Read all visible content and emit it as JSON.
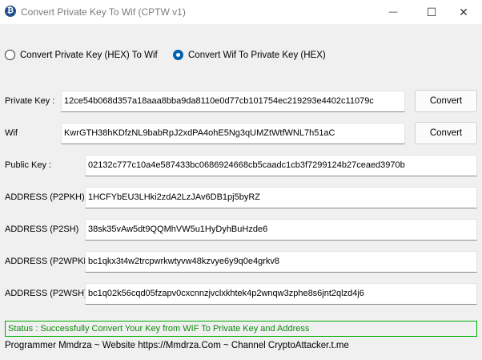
{
  "window": {
    "title": "Convert Private Key To Wif (CPTW v1)",
    "minimize_glyph": "—",
    "maximize_glyph": "☐",
    "close_glyph": "✕"
  },
  "radios": [
    {
      "label": "Convert Private Key (HEX) To Wif",
      "checked": false
    },
    {
      "label": "Convert Wif To Private Key (HEX)",
      "checked": true
    }
  ],
  "fields": {
    "private_key": {
      "label": "Private Key :",
      "value": "12ce54b068d357a18aaa8bba9da8110e0d77cb101754ec219293e4402c11079c"
    },
    "wif": {
      "label": "Wif",
      "value": "KwrGTH38hKDfzNL9babRpJ2xdPA4ohE5Ng3qUMZtWtfWNL7h51aC"
    },
    "public_key": {
      "label": "Public Key :",
      "value": "02132c777c10a4e587433bc0686924668cb5caadc1cb3f7299124b27ceaed3970b"
    },
    "p2pkh": {
      "label": "ADDRESS (P2PKH)",
      "value": "1HCFYbEU3LHki2zdA2LzJAv6DB1pj5byRZ"
    },
    "p2sh": {
      "label": "ADDRESS (P2SH)",
      "value": "38sk35vAw5dt9QQMhVW5u1HyDyhBuHzde6"
    },
    "p2wpkh": {
      "label": "ADDRESS (P2WPKH)",
      "value": "bc1qkx3t4w2trcpwrkwtyvw48kzvye6y9q0e4grkv8"
    },
    "p2wsh": {
      "label": "ADDRESS (P2WSH)",
      "value": "bc1q02k56cqd05fzapv0cxcnnzjvclxkhtek4p2wnqw3zphe8s6jnt2qlzd4j6"
    }
  },
  "buttons": {
    "convert_private": "Convert",
    "convert_wif": "Convert"
  },
  "status": "Status : Successfully Convert Your Key from WIF To Private Key and Address",
  "footer": "Programmer Mmdrza ~ Website https://Mmdrza.Com ~ Channel CryptoAttacker.t.me",
  "colors": {
    "status_border": "#00b000",
    "status_text": "#0f8a0f",
    "radio_selected": "#0063b1"
  }
}
